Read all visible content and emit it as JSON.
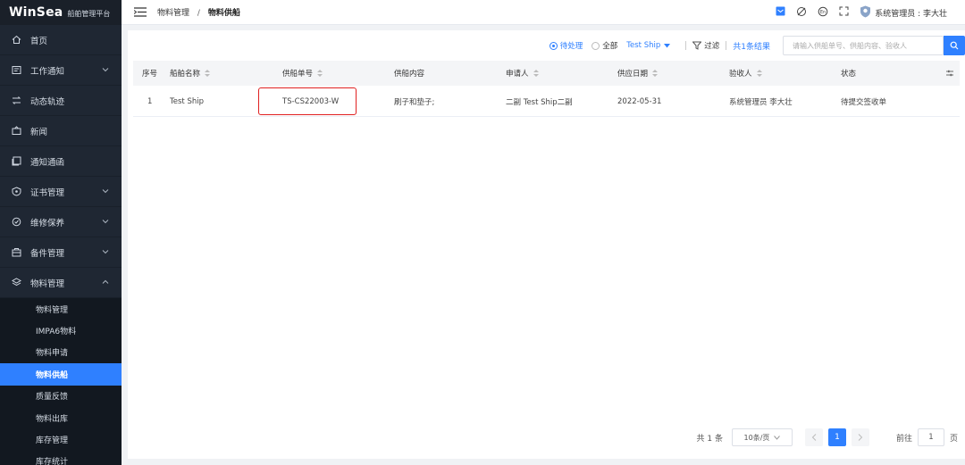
{
  "brand": {
    "logo": "WinSea",
    "subtitle": "船舶管理平台"
  },
  "sidebar": {
    "items": [
      {
        "label": "首页",
        "icon": "home-icon",
        "chevron": false
      },
      {
        "label": "工作通知",
        "icon": "notice-icon",
        "chevron": true
      },
      {
        "label": "动态轨迹",
        "icon": "track-icon",
        "chevron": false
      },
      {
        "label": "新闻",
        "icon": "news-icon",
        "chevron": false
      },
      {
        "label": "通知通函",
        "icon": "circular-icon",
        "chevron": false
      },
      {
        "label": "证书管理",
        "icon": "certificate-icon",
        "chevron": true
      },
      {
        "label": "维修保养",
        "icon": "maintenance-icon",
        "chevron": true
      },
      {
        "label": "备件管理",
        "icon": "spare-parts-icon",
        "chevron": true
      },
      {
        "label": "物料管理",
        "icon": "material-icon",
        "chevron": true,
        "expanded": true
      }
    ],
    "submenu": [
      {
        "label": "物料管理",
        "active": false
      },
      {
        "label": "IMPA6物料",
        "active": false
      },
      {
        "label": "物料申请",
        "active": false
      },
      {
        "label": "物料供船",
        "active": true
      },
      {
        "label": "质量反馈",
        "active": false
      },
      {
        "label": "物料出库",
        "active": false
      },
      {
        "label": "库存管理",
        "active": false
      },
      {
        "label": "库存统计",
        "active": false
      }
    ]
  },
  "header": {
    "breadcrumb": [
      "物料管理",
      "物料供船"
    ],
    "user_label": "系统管理员 : 李大壮"
  },
  "toolbar": {
    "radio_pending": "待处理",
    "radio_all": "全部",
    "ship_select": "Test Ship",
    "filter_label": "过滤",
    "total_label": "共1条结果",
    "search_placeholder": "请输入供船单号、供船内容、验收人"
  },
  "table": {
    "headers": [
      "序号",
      "船舶名称",
      "供船单号",
      "供船内容",
      "申请人",
      "供应日期",
      "验收人",
      "状态"
    ],
    "rows": [
      [
        "1",
        "Test Ship",
        "TS-CS22003-W",
        "刷子和垫子;",
        "二副 Test Ship二副",
        "2022-05-31",
        "系统管理员 李大壮",
        "待提交签收单"
      ]
    ]
  },
  "pagination": {
    "total_text": "共 1 条",
    "page_size": "10条/页",
    "current_page": "1",
    "goto_label": "前往",
    "goto_value": "1",
    "page_unit": "页"
  },
  "colors": {
    "accent": "#2f80ff",
    "sidebar_bg": "#1f2733",
    "highlight": "#e02020"
  }
}
